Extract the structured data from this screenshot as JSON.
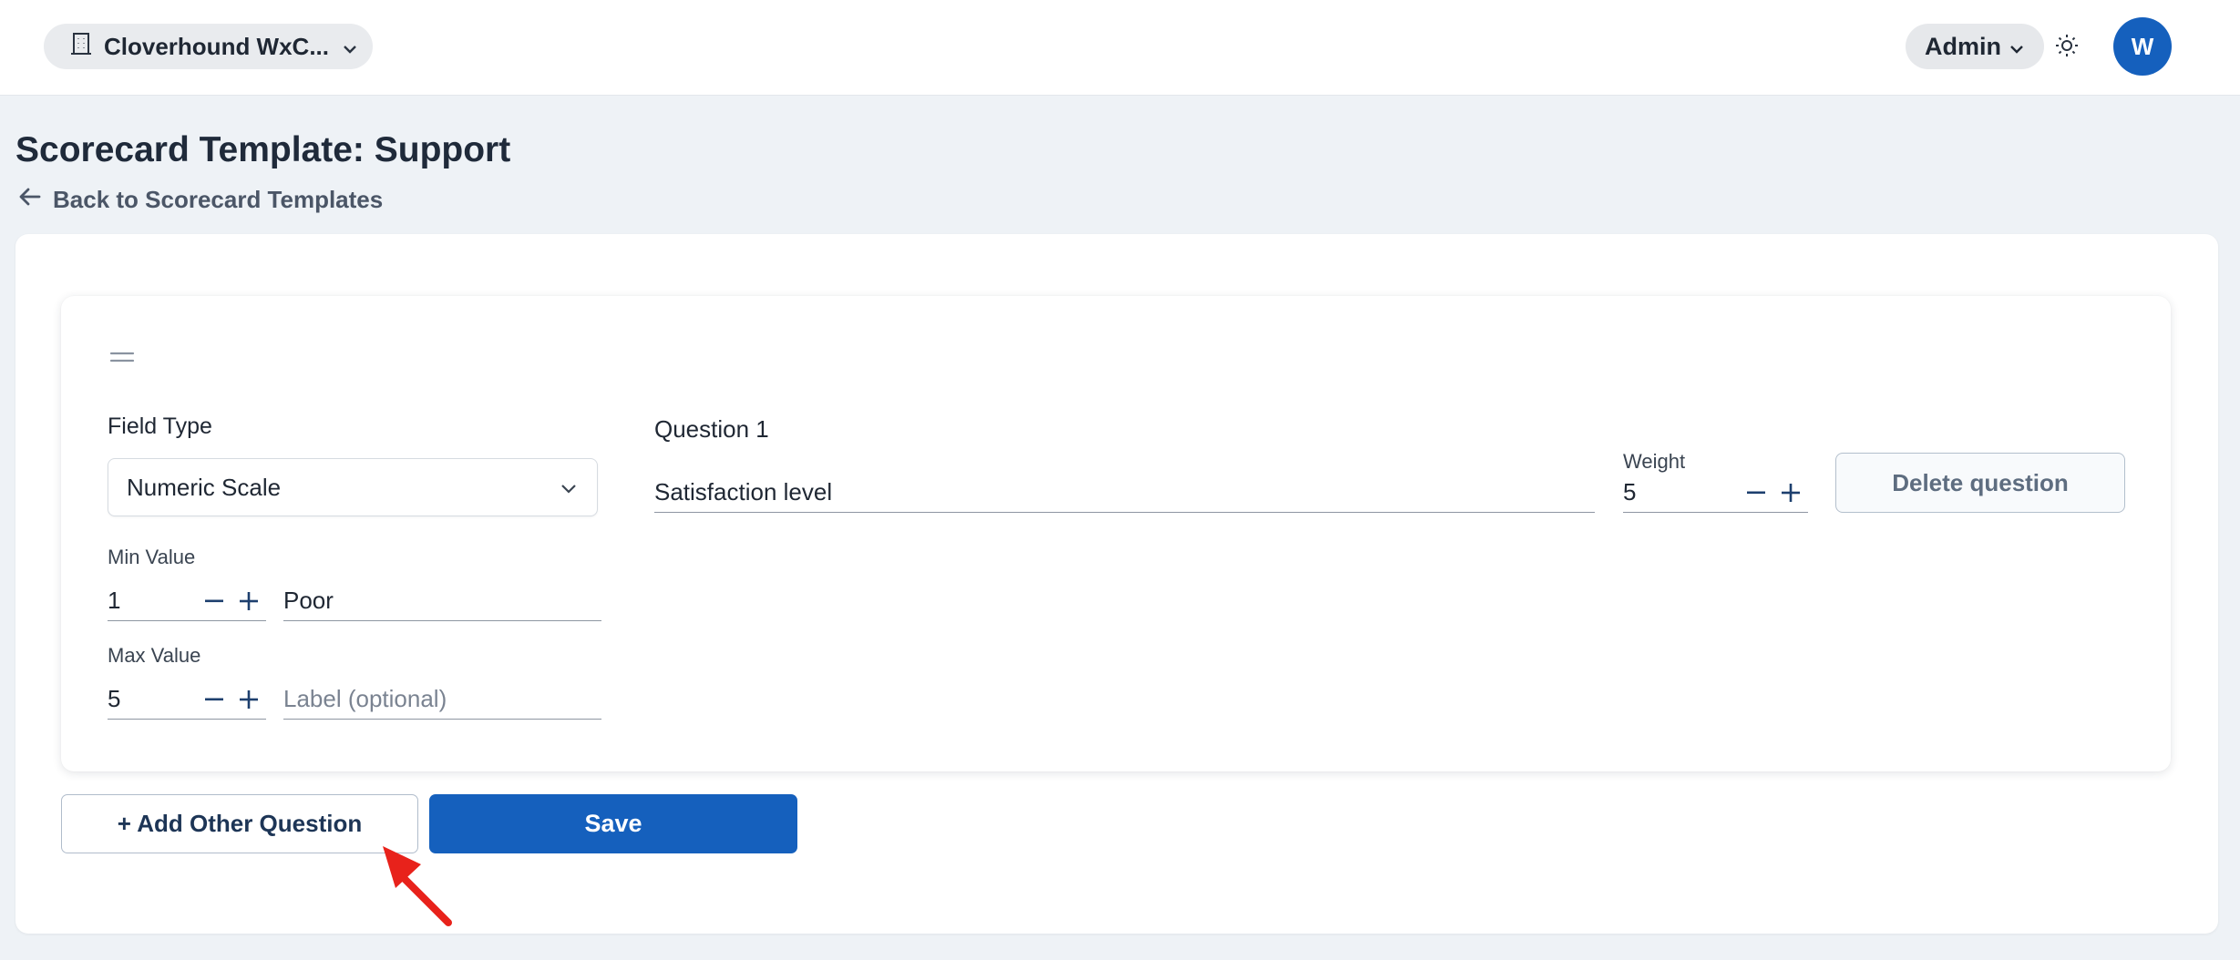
{
  "header": {
    "org_name": "Cloverhound WxC...",
    "role_label": "Admin",
    "avatar_initial": "W",
    "icons": {
      "org": "building-icon",
      "org_dropdown": "chevron-down-icon",
      "role_dropdown": "chevron-down-icon",
      "theme": "sun-icon"
    }
  },
  "page": {
    "title": "Scorecard Template: Support",
    "back_link": "Back to Scorecard Templates"
  },
  "question": {
    "field_type_label": "Field Type",
    "field_type_value": "Numeric Scale",
    "min_value_label": "Min Value",
    "min_value": "1",
    "min_label_value": "Poor",
    "max_value_label": "Max Value",
    "max_value": "5",
    "max_label_placeholder": "Label (optional)",
    "question_label": "Question 1",
    "question_text": "Satisfaction level",
    "weight_label": "Weight",
    "weight_value": "5",
    "delete_label": "Delete question"
  },
  "actions": {
    "add_label": "+ Add Other Question",
    "save_label": "Save"
  },
  "colors": {
    "primary": "#1560bd",
    "background": "#eef2f6",
    "annotation_arrow": "#e8221b"
  }
}
